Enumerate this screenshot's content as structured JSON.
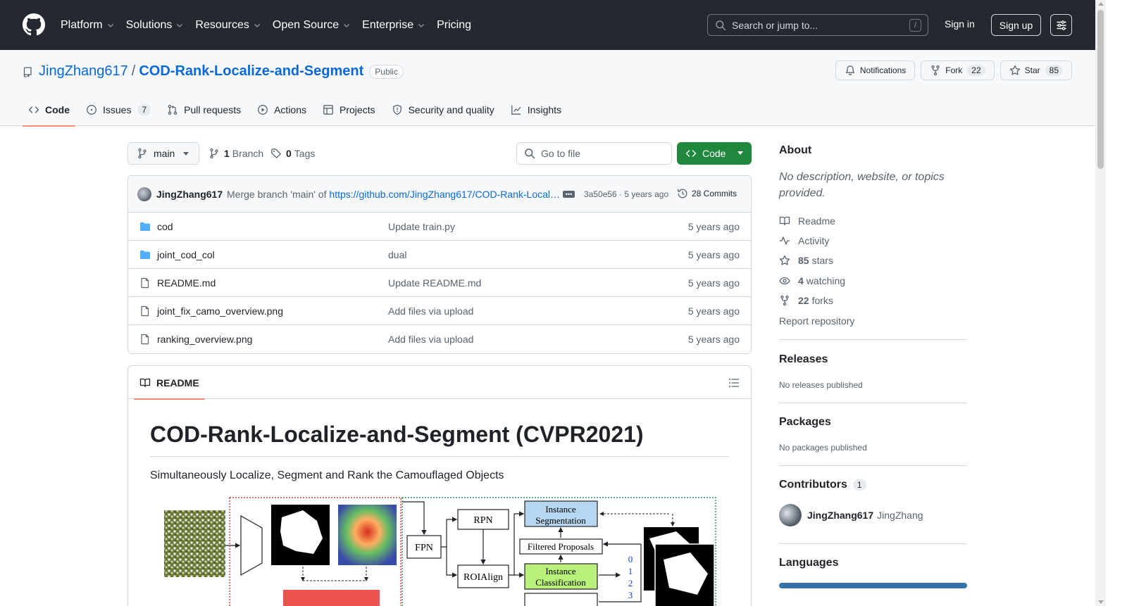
{
  "header": {
    "nav": [
      "Platform",
      "Solutions",
      "Resources",
      "Open Source",
      "Enterprise",
      "Pricing"
    ],
    "nav_has_menu": [
      true,
      true,
      true,
      true,
      true,
      false
    ],
    "search_placeholder": "Search or jump to...",
    "search_shortcut": "/",
    "signin": "Sign in",
    "signup": "Sign up"
  },
  "repo": {
    "owner": "JingZhang617",
    "separator": "/",
    "name": "COD-Rank-Localize-and-Segment",
    "visibility": "Public",
    "notifications": "Notifications",
    "fork_label": "Fork",
    "fork_count": "22",
    "star_label": "Star",
    "star_count": "85",
    "tabs": [
      {
        "label": "Code",
        "icon": "code-icon",
        "count": ""
      },
      {
        "label": "Issues",
        "icon": "issue-opened-icon",
        "count": "7"
      },
      {
        "label": "Pull requests",
        "icon": "git-pull-request-icon",
        "count": ""
      },
      {
        "label": "Actions",
        "icon": "play-icon",
        "count": ""
      },
      {
        "label": "Projects",
        "icon": "table-icon",
        "count": ""
      },
      {
        "label": "Security and quality",
        "icon": "shield-icon",
        "count": ""
      },
      {
        "label": "Insights",
        "icon": "graph-icon",
        "count": ""
      }
    ]
  },
  "toolbar": {
    "branch": "main",
    "branch_count": "1",
    "branch_label": "Branch",
    "tag_count": "0",
    "tag_label": "Tags",
    "goto_placeholder": "Go to file",
    "code_button": "Code"
  },
  "commit": {
    "author": "JingZhang617",
    "message_prefix": "Merge branch 'main' of ",
    "message_link": "https://github.com/JingZhang617/COD-Rank-Local…",
    "ellipsis": "•••",
    "sha_time": "3a50e56 · 5 years ago",
    "commits_count": "28 Commits"
  },
  "files": [
    {
      "name": "cod",
      "type": "folder",
      "message": "Update train.py",
      "date": "5 years ago"
    },
    {
      "name": "joint_cod_col",
      "type": "folder",
      "message": "dual",
      "date": "5 years ago"
    },
    {
      "name": "README.md",
      "type": "file",
      "message": "Update README.md",
      "date": "5 years ago"
    },
    {
      "name": "joint_fix_camo_overview.png",
      "type": "file",
      "message": "Add files via upload",
      "date": "5 years ago"
    },
    {
      "name": "ranking_overview.png",
      "type": "file",
      "message": "Add files via upload",
      "date": "5 years ago"
    }
  ],
  "readme": {
    "tab_label": "README",
    "title": "COD-Rank-Localize-and-Segment (CVPR2021)",
    "subtitle": "Simultaneously Localize, Segment and Rank the Camouflaged Objects",
    "figure": {
      "rpn": "RPN",
      "fpn": "FPN",
      "roialign": "ROIAlign",
      "inst_seg_1": "Instance",
      "inst_seg_2": "Segmentation",
      "filtered": "Filtered Proposals",
      "inst_cls_1": "Instance",
      "inst_cls_2": "Classification",
      "rank_0": "0",
      "rank_1": "1",
      "rank_2": "2",
      "rank_3": "3"
    }
  },
  "sidebar": {
    "about_title": "About",
    "about_desc": "No description, website, or topics provided.",
    "readme": "Readme",
    "activity": "Activity",
    "stars_count": "85",
    "stars_label": "stars",
    "watching_count": "4",
    "watching_label": "watching",
    "forks_count": "22",
    "forks_label": "forks",
    "report": "Report repository",
    "releases_title": "Releases",
    "releases_note": "No releases published",
    "packages_title": "Packages",
    "packages_note": "No packages published",
    "contributors_title": "Contributors",
    "contributors_count": "1",
    "contributor_login": "JingZhang617",
    "contributor_name": "JingZhang",
    "languages_title": "Languages"
  },
  "colors": {
    "header_bg": "#24292f",
    "link": "#0969da",
    "primary_button": "#1f883d",
    "tab_underline": "#fd8c73",
    "language_bar": "#3572a5"
  }
}
